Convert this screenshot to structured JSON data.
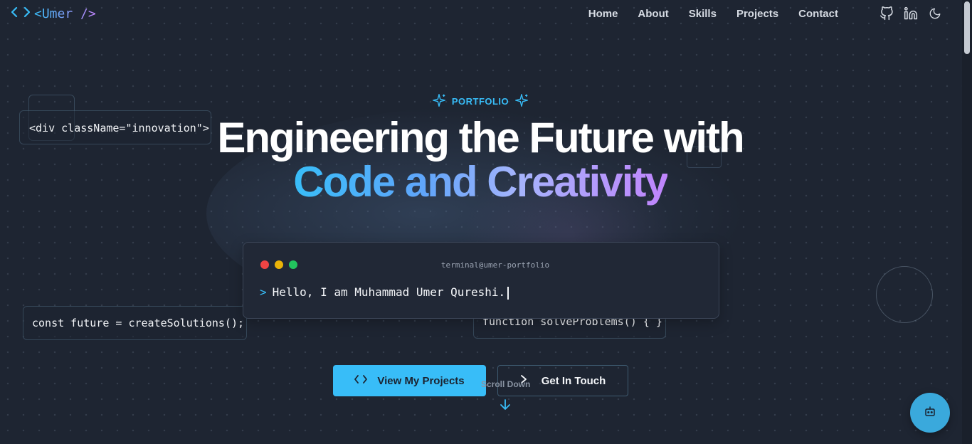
{
  "brand": {
    "bracket_icon": "code-brackets-icon",
    "text": "<Umer />"
  },
  "nav": {
    "links": [
      "Home",
      "About",
      "Skills",
      "Projects",
      "Contact"
    ],
    "icons": [
      "github-icon",
      "linkedin-icon",
      "moon-icon"
    ]
  },
  "hero": {
    "badge": "PORTFOLIO",
    "badge_icon": "sparkle-icon",
    "title_line1": "Engineering the Future with",
    "title_line2": "Code and Creativity",
    "gradient_colors": [
      "#38bdf8",
      "#c084fc"
    ]
  },
  "floating_code": {
    "snippet1": "<div className=\"innovation\">",
    "snippet2": "const future = createSolutions();",
    "snippet3": "function solveProblems() { }"
  },
  "terminal": {
    "title": "terminal@umer-portfolio",
    "prompt": ">",
    "line": "Hello, I am Muhammad Umer Qureshi.",
    "dot_colors": [
      "#ef4444",
      "#eab308",
      "#22c55e"
    ]
  },
  "cta": {
    "primary_label": "View My Projects",
    "primary_icon": "code-icon",
    "secondary_label": "Get In Touch",
    "secondary_icon": "chevron-right-icon"
  },
  "scroll": {
    "label": "Scroll Down",
    "icon": "arrow-down-icon"
  },
  "chat": {
    "icon": "robot-icon"
  },
  "colors": {
    "accent": "#38bdf8",
    "background": "#1e2532"
  }
}
